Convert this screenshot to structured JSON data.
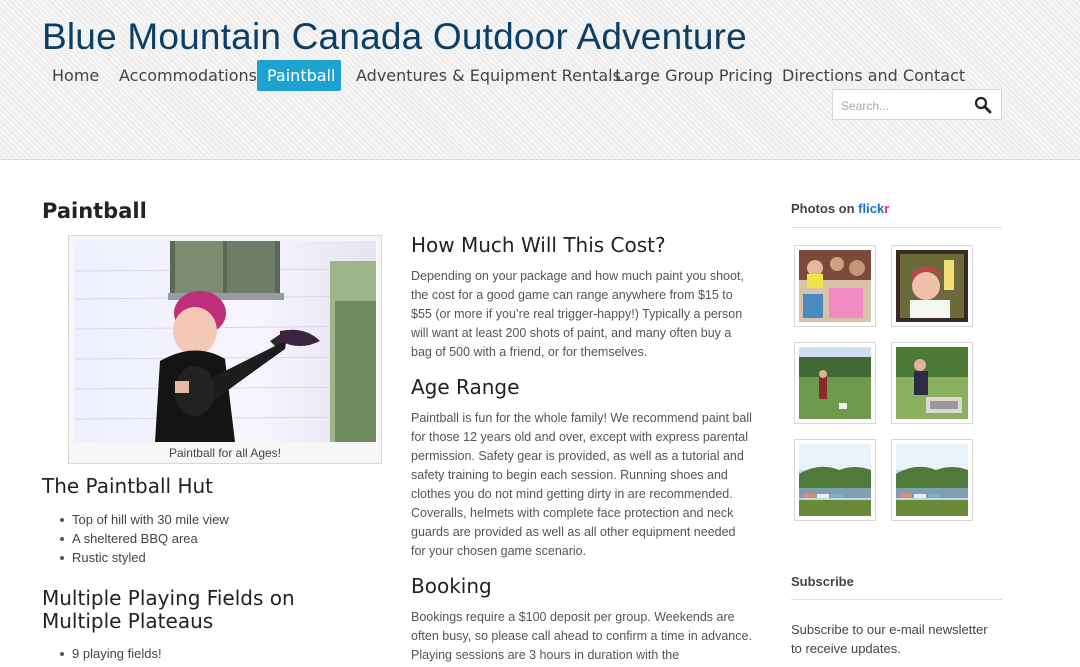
{
  "site": {
    "title": "Blue Mountain Canada Outdoor Adventure"
  },
  "nav": {
    "items": [
      {
        "label": "Home",
        "active": false
      },
      {
        "label": "Accommodations",
        "active": false
      },
      {
        "label": "Paintball",
        "active": true
      },
      {
        "label": "Adventures & Equipment Rentals",
        "active": false
      },
      {
        "label": "Large Group Pricing",
        "active": false
      },
      {
        "label": "Directions and Contact",
        "active": false
      }
    ]
  },
  "search": {
    "placeholder": "Search..."
  },
  "page": {
    "title": "Paintball",
    "figure_caption": "Paintball for all Ages!",
    "hut": {
      "heading": "The Paintball Hut",
      "items": [
        "Top of hill with 30 mile view",
        "A sheltered BBQ area",
        "Rustic styled"
      ]
    },
    "fields": {
      "heading": "Multiple Playing Fields on Multiple Plateaus",
      "items": [
        "9 playing fields!"
      ]
    },
    "cost": {
      "heading": "How Much Will This Cost?",
      "text": "Depending on your package and how much paint you shoot, the cost for a good game can range anywhere from $15 to $55 (or more if you’re real trigger-happy!) Typically a person will want at least 200 shots of paint, and many often buy a bag of 500 with a friend, or for themselves."
    },
    "age": {
      "heading": "Age Range",
      "text": "Paintball is fun for the whole family! We recommend paint ball for those 12 years old and over, except with express parental permission. Safety gear is provided, as well as a tutorial and safety training to begin each session. Running shoes and clothes you do not mind getting dirty in are recommended. Coveralls, helmets with complete face protection and neck guards are provided as well as all other equipment needed for your chosen game scenario."
    },
    "booking": {
      "heading": "Booking",
      "text": "Bookings require a $100 deposit per group. Weekends are often busy, so please call ahead to confirm a time in advance. Playing sessions are 3 hours in duration with the"
    }
  },
  "sidebar": {
    "photos_prefix": "Photos on",
    "flickr_a": "flick",
    "flickr_b": "r",
    "subscribe_title": "Subscribe",
    "subscribe_text": "Subscribe to our e-mail newsletter to receive updates."
  },
  "colors": {
    "accent": "#1ea3d0",
    "title": "#0b3f66",
    "flickr_blue": "#1a6cd6",
    "flickr_pink": "#ff1b84"
  }
}
